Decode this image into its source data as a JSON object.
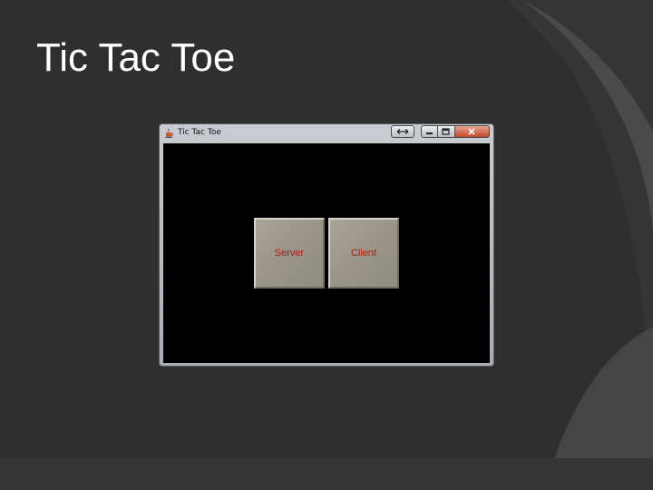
{
  "slide": {
    "title": "Tic Tac Toe"
  },
  "window": {
    "title": "Tic Tac Toe",
    "icon": "java-cup-icon",
    "controls": [
      "resize-icon",
      "minimize-icon",
      "maximize-icon",
      "close-icon"
    ]
  },
  "buttons": {
    "server_label": "Server",
    "client_label": "Client"
  },
  "colors": {
    "slide_background": "#2f2f2f",
    "slide_arc": "#4a4a4a",
    "client_area": "#000000",
    "button_face": "#9a978a",
    "button_text": "#b11a0e",
    "close_button": "#c3492a"
  }
}
